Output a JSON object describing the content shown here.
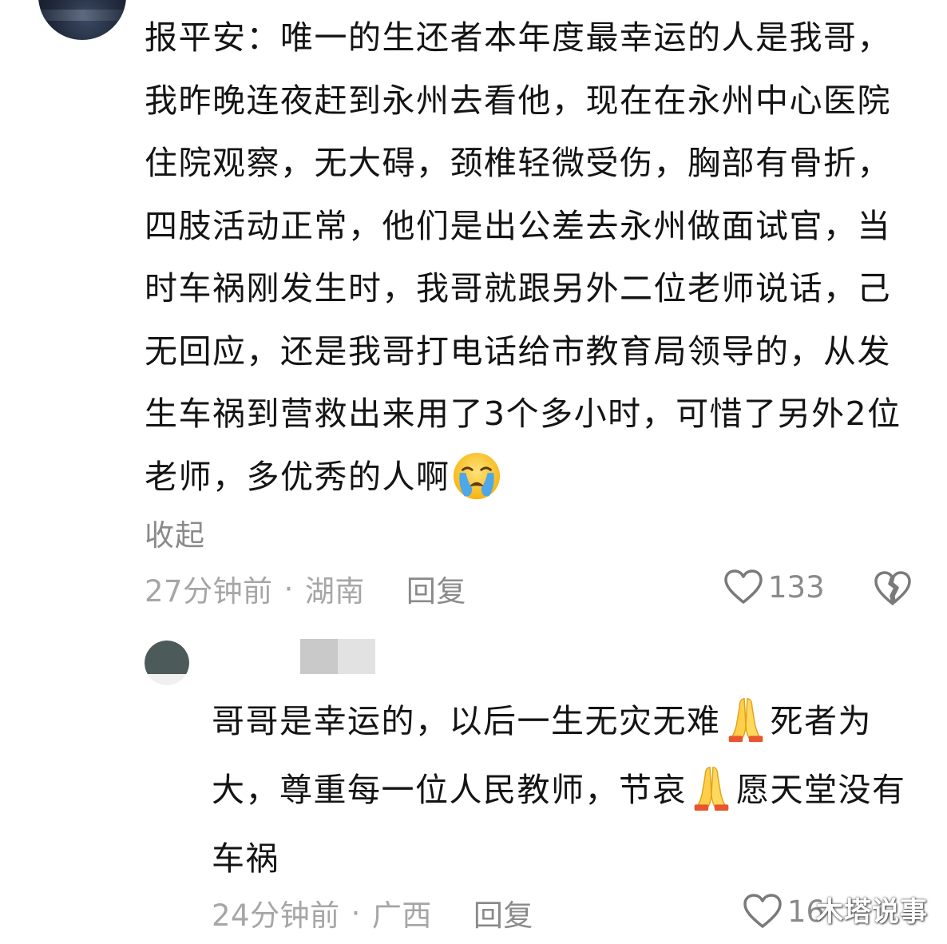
{
  "comment": {
    "text": "报平安：唯一的生还者本年度最幸运的人是我哥，我昨晚连夜赶到永州去看他，现在在永州中心医院住院观察，无大碍，颈椎轻微受伤，胸部有骨折，四肢活动正常，他们是出公差去永州做面试官，当时车祸刚发生时，我哥就跟另外二位老师说话，己无回应，还是我哥打电话给市教育局领导的，从发生车祸到营救出来用了3个多小时，可惜了另外2位老师，多优秀的人啊",
    "emoji": "crying-face",
    "collapse_label": "收起",
    "time": "27分钟前",
    "separator": "·",
    "location": "湖南",
    "reply_label": "回复",
    "likes": "133"
  },
  "reply": {
    "text_part1": "哥哥是幸运的，以后一生无灾无难",
    "text_part2": "死者为大，尊重每一位人民教师，节哀",
    "text_part3": "愿天堂没有车祸",
    "emoji": "folded-hands",
    "time": "24分钟前",
    "separator": "·",
    "location": "广西",
    "reply_label": "回复",
    "likes": "16"
  },
  "watermark": "木塔说事"
}
